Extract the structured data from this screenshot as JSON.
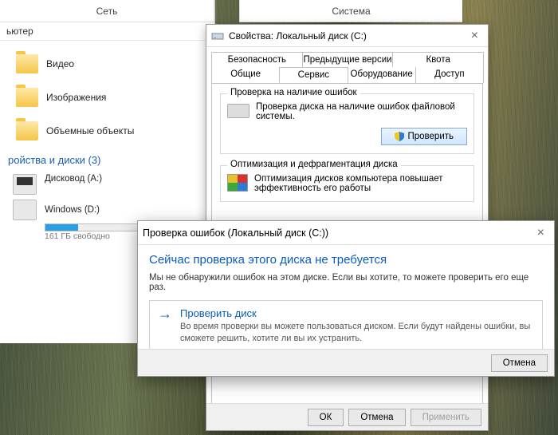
{
  "explorer": {
    "top_tabs": [
      "Сеть",
      "Система"
    ],
    "breadcrumb": "ьютер",
    "items": [
      {
        "label": "Видео"
      },
      {
        "label": "Изображения"
      },
      {
        "label": "Объемные объекты"
      }
    ],
    "section": "ройства и диски (3)",
    "drives": [
      {
        "name": "Дисковод (A:)"
      },
      {
        "name": "Windows (D:)",
        "barPct": 30,
        "free": "161 ГБ свободно"
      }
    ]
  },
  "props": {
    "title": "Свойства: Локальный диск (C:)",
    "tabs_row1": [
      "Безопасность",
      "Предыдущие версии",
      "Квота"
    ],
    "tabs_row2": [
      "Общие",
      "Сервис",
      "Оборудование",
      "Доступ"
    ],
    "active_tab": "Сервис",
    "group_check": {
      "title": "Проверка на наличие ошибок",
      "text": "Проверка диска на наличие ошибок файловой системы.",
      "button": "Проверить"
    },
    "group_defrag": {
      "title": "Оптимизация и дефрагментация диска",
      "text": "Оптимизация дисков компьютера повышает эффективность его работы"
    },
    "buttons": {
      "ok": "ОК",
      "cancel": "Отмена",
      "apply": "Применить"
    }
  },
  "check": {
    "title": "Проверка ошибок (Локальный диск (C:))",
    "heading": "Сейчас проверка этого диска не требуется",
    "para": "Мы не обнаружили ошибок на этом диске. Если вы хотите, то можете проверить его еще раз.",
    "action_title": "Проверить диск",
    "action_desc": "Во время проверки вы можете пользоваться диском. Если будут найдены ошибки, вы сможете решить, хотите ли вы их устранить.",
    "cancel": "Отмена"
  }
}
